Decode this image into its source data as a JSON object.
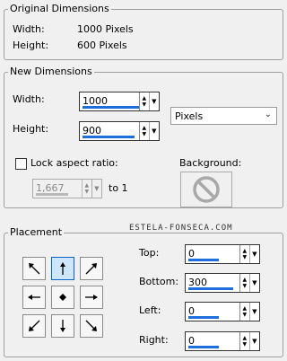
{
  "original": {
    "title": "Original Dimensions",
    "width_label": "Width:",
    "width_value": "1000 Pixels",
    "height_label": "Height:",
    "height_value": "600 Pixels"
  },
  "new_dims": {
    "title": "New Dimensions",
    "width_label": "Width:",
    "width_value": "1000",
    "height_label": "Height:",
    "height_value": "900",
    "units_value": "Pixels",
    "lock_label": "Lock aspect ratio:",
    "ratio_value": "1,667",
    "to_one": "to 1",
    "background_label": "Background:"
  },
  "placement": {
    "title": "Placement",
    "watermark": "ESTELA-FONSECA.COM",
    "top_label": "Top:",
    "top_value": "0",
    "bottom_label": "Bottom:",
    "bottom_value": "300",
    "left_label": "Left:",
    "left_value": "0",
    "right_label": "Right:",
    "right_value": "0",
    "selected_anchor": "top-center"
  },
  "colors": {
    "accent": "#1e6fd9",
    "active_fill": "#cde6fb"
  }
}
